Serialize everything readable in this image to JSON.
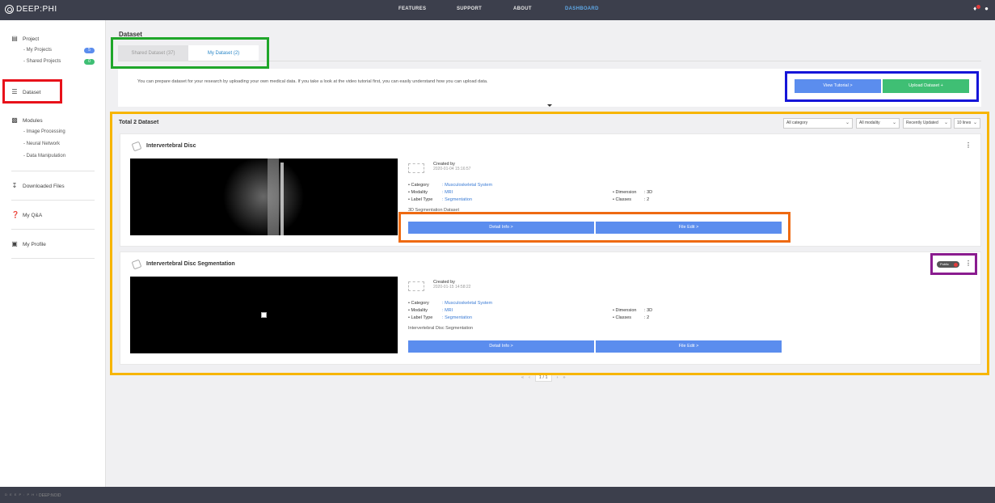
{
  "topbar": {
    "logo": "DEEP:PHI",
    "nav": [
      "FEATURES",
      "SUPPORT",
      "ABOUT",
      "DASHBOARD"
    ],
    "active_nav": "DASHBOARD",
    "icons": [
      "bell-icon",
      "user-icon"
    ]
  },
  "sidebar": {
    "project": {
      "label": "Project",
      "icon": "clipboard-icon"
    },
    "my_projects": {
      "label": "- My Projects",
      "count": "5"
    },
    "shared_projects": {
      "label": "- Shared Projects",
      "count": "0"
    },
    "dataset": {
      "label": "Dataset",
      "icon": "database-icon"
    },
    "modules": {
      "label": "Modules",
      "icon": "cubes-icon"
    },
    "modules_items": [
      "- Image Processing",
      "- Neural Network",
      "- Data Manipulation"
    ],
    "downloaded": {
      "label": "Downloaded Files",
      "icon": "download-icon"
    },
    "qa": {
      "label": "My Q&A",
      "icon": "question-icon"
    },
    "profile": {
      "label": "My Profile",
      "icon": "id-card-icon"
    }
  },
  "main": {
    "title": "Dataset",
    "tabs": [
      {
        "label": "Shared Dataset (37)"
      },
      {
        "label": "My Dataset (2)"
      }
    ],
    "info_text": "You can prepare dataset for your research by uploading your own medical data. If you take a look at the video tutorial first, you can easily understand how you can upload data.",
    "view_tutorial": "View Tutorial >",
    "upload_dataset": "Upload Dataset +",
    "total": "Total 2 Dataset",
    "filters": {
      "category": "All category",
      "modality": "All modality",
      "sort": "Recently Updated",
      "lines": "10 lines"
    }
  },
  "cards": [
    {
      "title": "Intervertebral Disc",
      "created_by": "Created by",
      "created_date": "2020-01-04 15:16:57",
      "category_k": "Category",
      "category_v": "Musculoskeletal System",
      "modality_k": "Modality",
      "modality_v": "MRI",
      "label_k": "Label Type",
      "label_v": "Segmentation",
      "dimension_k": "Dimension",
      "dimension_v": "3D",
      "classes_k": "Classes",
      "classes_v": "2",
      "desc": "3D Segmentation Dataset",
      "detail_btn": "Detail Info >",
      "file_btn": "File Edit >"
    },
    {
      "title": "Intervertebral Disc Segmentation",
      "created_by": "Created by",
      "created_date": "2020-01-15 14:58:22",
      "category_k": "Category",
      "category_v": "Musculoskeletal System",
      "modality_k": "Modality",
      "modality_v": "MRI",
      "label_k": "Label Type",
      "label_v": "Segmentation",
      "dimension_k": "Dimension",
      "dimension_v": "3D",
      "classes_k": "Classes",
      "classes_v": "2",
      "desc": "Intervertebral Disc Segmentation",
      "detail_btn": "Detail Info >",
      "file_btn": "File Edit >",
      "status": "Public"
    }
  ],
  "pager": {
    "current": "1 / 1"
  },
  "footer": {
    "mark": "D E E P : P H I",
    "label": "DEEP:NOID"
  },
  "colors": {
    "topbar": "#3c3f4c",
    "accent": "#5b8dee",
    "green": "#3fbf74",
    "hl_red": "#e8111a",
    "hl_green": "#1fa62a",
    "hl_blue": "#1515d8",
    "hl_yellow": "#f7b500",
    "hl_orange": "#ee6a12",
    "hl_purple": "#8a1c8f"
  }
}
